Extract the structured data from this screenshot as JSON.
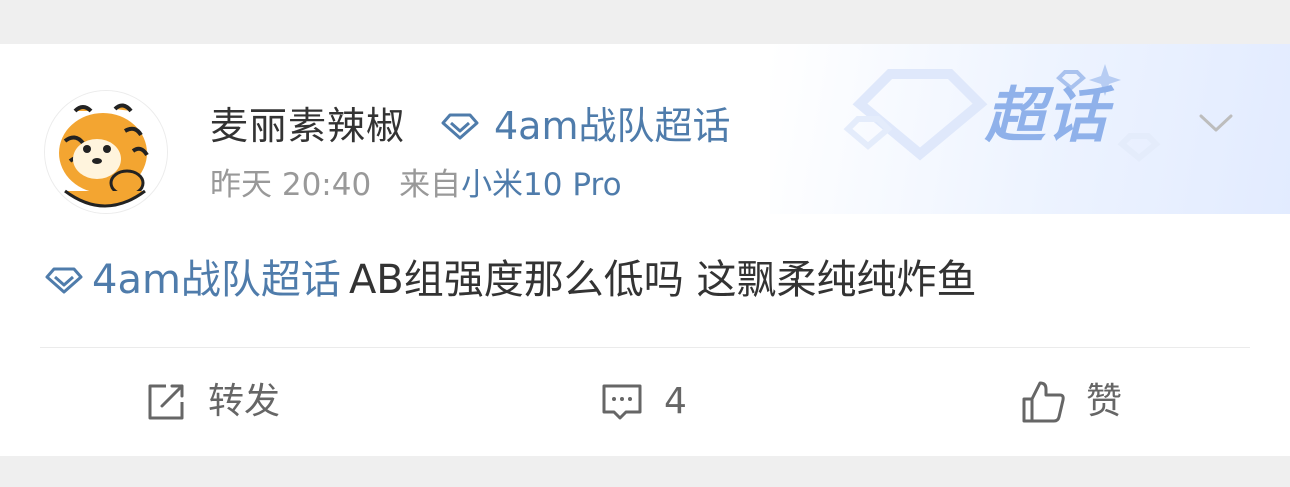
{
  "post": {
    "username": "麦丽素辣椒",
    "supertopic_label": "4am战队超话",
    "time": "昨天 20:40",
    "source_prefix": "来自",
    "source_device": "小米10 Pro",
    "badge": "超话",
    "content_topic": "4am战队超话",
    "content_text": "AB组强度那么低吗 这飘柔纯纯炸鱼"
  },
  "actions": {
    "repost_label": "转发",
    "comment_count": "4",
    "like_label": "赞"
  },
  "colors": {
    "link": "#4f7cab",
    "text": "#333333",
    "meta": "#999999",
    "badge": "#8fb1ea"
  },
  "icons": [
    "diamond-icon",
    "chevron-down-icon",
    "repost-icon",
    "comment-icon",
    "like-icon"
  ]
}
